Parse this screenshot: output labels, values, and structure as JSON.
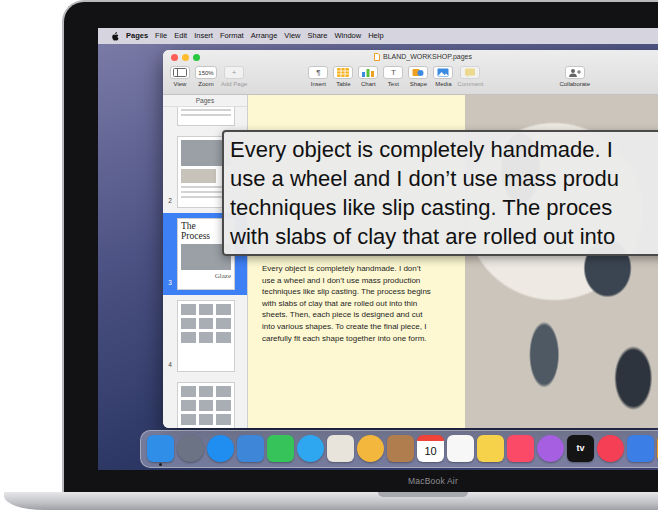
{
  "menu_bar": {
    "app": "Pages",
    "items": [
      "File",
      "Edit",
      "Insert",
      "Format",
      "Arrange",
      "View",
      "Share",
      "Window",
      "Help"
    ]
  },
  "window": {
    "title": "BLAND_WORKSHOP.pages"
  },
  "toolbar": {
    "left": [
      {
        "label": "View",
        "kind": "view",
        "disabled": false
      },
      {
        "label": "Zoom",
        "kind": "zoom",
        "value": "150%",
        "disabled": false
      },
      {
        "label": "Add Page",
        "kind": "glyph",
        "glyph": "+",
        "disabled": true
      }
    ],
    "middle": [
      {
        "label": "Insert",
        "kind": "glyph",
        "glyph": "¶",
        "disabled": false
      },
      {
        "label": "Table",
        "kind": "table",
        "disabled": false
      },
      {
        "label": "Chart",
        "kind": "chart",
        "disabled": false
      },
      {
        "label": "Text",
        "kind": "glyph",
        "glyph": "T",
        "disabled": false
      },
      {
        "label": "Shape",
        "kind": "shape",
        "disabled": false
      },
      {
        "label": "Media",
        "kind": "media",
        "disabled": false
      },
      {
        "label": "Comment",
        "kind": "comment",
        "disabled": true
      }
    ],
    "right": [
      {
        "label": "Collaborate",
        "kind": "collab",
        "disabled": false
      }
    ]
  },
  "sidebar": {
    "title": "Pages",
    "pages": [
      {
        "kind": "photo",
        "selected": false
      },
      {
        "number": "2",
        "kind": "photo",
        "selected": false
      },
      {
        "number": "3",
        "kind": "title",
        "heading": "The Process",
        "caption": "Glaze",
        "selected": true
      },
      {
        "number": "4",
        "kind": "grid",
        "selected": false
      },
      {
        "kind": "grid",
        "selected": false
      }
    ]
  },
  "document": {
    "text": "Every object is completely handmade. I don’t use a wheel and I don’t use mass production techniques like slip casting. The process begins with slabs of clay that are rolled out into thin sheets. Then, each piece is designed and cut into various shapes. To create the final piece, I carefully fit each shape together into one form."
  },
  "hover_text": {
    "lines": [
      "Every object is completely handmade. I",
      "use a wheel and I don’t use mass produ",
      "techniques like slip casting. The proces",
      "with slabs of clay that are rolled out into"
    ]
  },
  "dock": {
    "items": [
      {
        "kind": "square",
        "color": "#2f8fe8",
        "running": true
      },
      {
        "kind": "round",
        "color": "#6b7384",
        "running": false
      },
      {
        "kind": "round",
        "color": "#1f8ef0",
        "running": false
      },
      {
        "kind": "square",
        "color": "#3d86d8",
        "running": false
      },
      {
        "kind": "square",
        "color": "#35c35a",
        "running": false
      },
      {
        "kind": "round",
        "color": "#2fa7f0",
        "running": false
      },
      {
        "kind": "square",
        "color": "#e8e4dc",
        "running": false
      },
      {
        "kind": "round",
        "color": "#f4b73d",
        "running": false
      },
      {
        "kind": "square",
        "color": "#b07d4f",
        "running": false
      },
      {
        "kind": "calendar",
        "color": "#ffffff",
        "label": "10",
        "running": false
      },
      {
        "kind": "square",
        "color": "#f7f7f7",
        "running": false
      },
      {
        "kind": "square",
        "color": "#f6d24a",
        "running": false
      },
      {
        "kind": "square",
        "color": "#fb4a67",
        "running": false
      },
      {
        "kind": "round",
        "color": "#a55fe0",
        "running": false
      },
      {
        "kind": "tv",
        "color": "#141414",
        "label": "tv",
        "running": false
      },
      {
        "kind": "round",
        "color": "#f43f55",
        "running": false
      },
      {
        "kind": "square",
        "color": "#3b7fe6",
        "running": false
      },
      {
        "kind": "square",
        "color": "#f29a1f",
        "running": false
      }
    ]
  },
  "device": {
    "label": "MacBook Air"
  }
}
